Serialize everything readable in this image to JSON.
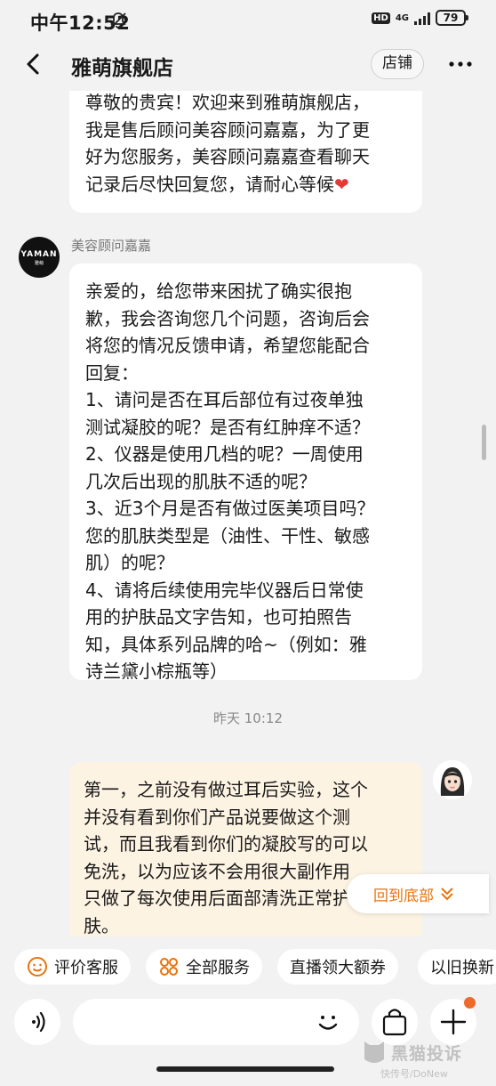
{
  "status": {
    "time": "中午12:52",
    "hd": "HD",
    "network": "4G",
    "battery": "79"
  },
  "header": {
    "title": "雅萌旗舰店",
    "shop_button": "店铺"
  },
  "messages": [
    {
      "side": "left",
      "text": "尊敬的贵宾！欢迎来到雅萌旗舰店，\n我是售后顾问美容顾问嘉嘉，为了更\n好为您服务，美容顾问嘉嘉查看聊天\n记录后尽快回复您，请耐心等候",
      "emoji": "❤"
    },
    {
      "side": "left",
      "sender": "美容顾问嘉嘉",
      "avatar_brand": "YAMAN",
      "avatar_sub": "雅萌",
      "text": "亲爱的，给您带来困扰了确实很抱\n歉，我会咨询您几个问题，咨询后会\n将您的情况反馈申请，希望您能配合\n回复：\n1、请问是否在耳后部位有过夜单独\n测试凝胶的呢？是否有红肿痒不适？\n2、仪器是使用几档的呢？一周使用\n几次后出现的肌肤不适的呢？\n3、近3个月是否有做过医美项目吗？\n您的肌肤类型是（油性、干性、敏感\n肌）的呢？\n4、请将后续使用完毕仪器后日常使\n用的护肤品文字告知，也可拍照告\n知，具体系列品牌的哈~（例如：雅\n诗兰黛小棕瓶等）"
    },
    {
      "side": "right",
      "text": "第一，之前没有做过耳后实验，这个\n并没有看到你们产品说要做这个测\n试，而且我看到你们的凝胶写的可以\n免洗，以为应该不会用很大副作用\n只做了每次使用后面部清洗正常护\n肤。"
    }
  ],
  "timestamp": "昨天  10:12",
  "back_to_bottom": "回到底部",
  "quick_actions": [
    {
      "label": "评价客服",
      "icon": "smile-icon"
    },
    {
      "label": "全部服务",
      "icon": "grid-icon"
    },
    {
      "label": "直播领大额券",
      "icon": ""
    },
    {
      "label": "以旧换新",
      "icon": ""
    }
  ],
  "input": {
    "placeholder": ""
  },
  "watermark": {
    "title": "黑猫投诉",
    "sub": "快传号/DoNew"
  },
  "colors": {
    "accent": "#e8730c",
    "user_bubble": "#fdf3e3",
    "background": "#f2f2f2"
  }
}
